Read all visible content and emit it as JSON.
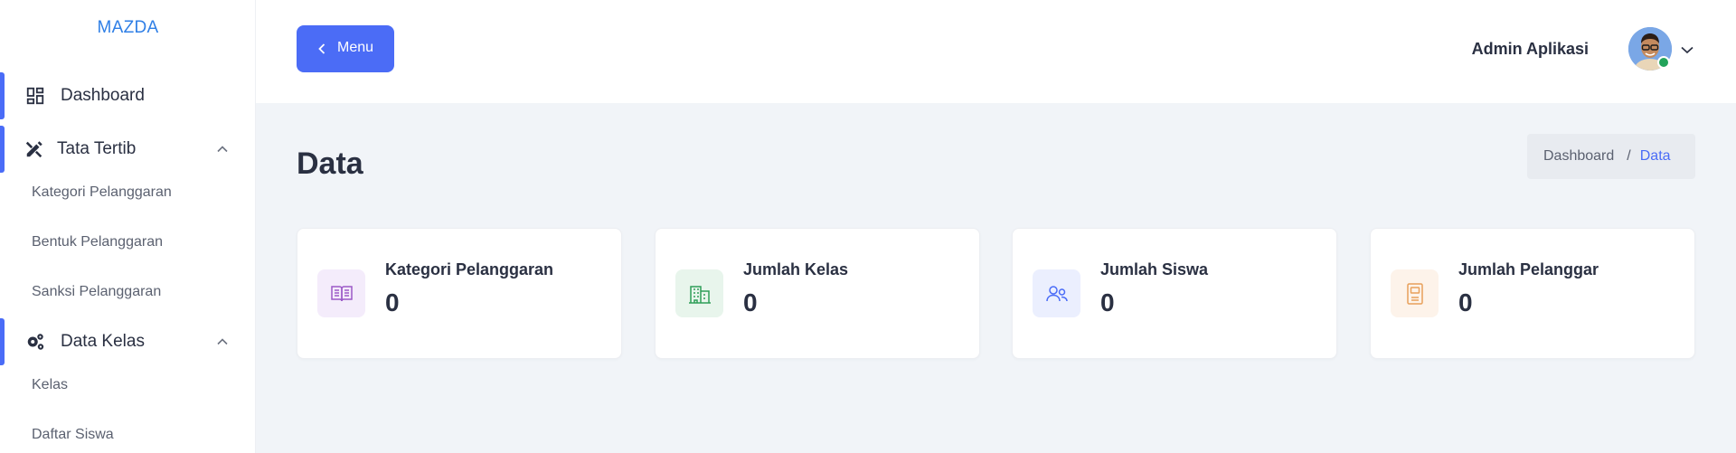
{
  "app": {
    "brand": "MAZDA"
  },
  "sidebar": {
    "items": [
      {
        "label": "Dashboard",
        "icon": "dashboard-grid-icon",
        "active": true
      },
      {
        "label": "Tata Tertib",
        "icon": "pencil-ruler-icon",
        "expanded": true,
        "children": [
          "Kategori Pelanggaran",
          "Bentuk Pelanggaran",
          "Sanksi Pelanggaran"
        ]
      },
      {
        "label": "Data Kelas",
        "icon": "gears-icon",
        "expanded": true,
        "children": [
          "Kelas",
          "Daftar Siswa"
        ]
      }
    ]
  },
  "header": {
    "menu_label": "Menu",
    "user_name": "Admin Aplikasi",
    "user_status": "online"
  },
  "page": {
    "title": "Data",
    "breadcrumb": {
      "home": "Dashboard",
      "separator": "/",
      "current": "Data"
    }
  },
  "cards": [
    {
      "title": "Kategori Pelanggaran",
      "value": "0",
      "icon": "book-open-icon",
      "color": "#9b59c8",
      "bg": "#f4ecfb"
    },
    {
      "title": "Jumlah Kelas",
      "value": "0",
      "icon": "building-icon",
      "color": "#2f9e58",
      "bg": "#e8f5ec"
    },
    {
      "title": "Jumlah Siswa",
      "value": "0",
      "icon": "users-icon",
      "color": "#4a6cf7",
      "bg": "#ebeffe"
    },
    {
      "title": "Jumlah Pelanggar",
      "value": "0",
      "icon": "notebook-icon",
      "color": "#e8a05a",
      "bg": "#fdf3ea"
    }
  ],
  "colors": {
    "accent": "#4a6cf7",
    "brand": "#2f7fe6",
    "background": "#f1f4f8"
  }
}
